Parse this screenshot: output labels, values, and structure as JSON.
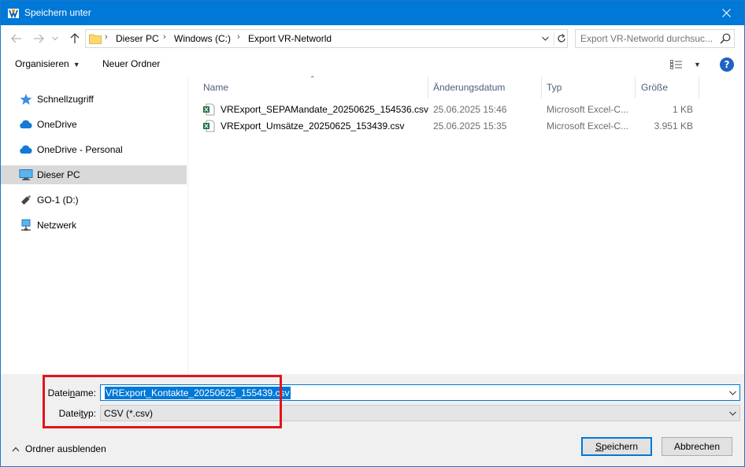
{
  "window": {
    "title": "Speichern unter"
  },
  "address_bar": {
    "crumbs": [
      "Dieser PC",
      "Windows (C:)",
      "Export VR-Networld"
    ]
  },
  "search": {
    "placeholder": "Export VR-Networld durchsuc..."
  },
  "toolbar": {
    "organize_label": "Organisieren",
    "new_folder_label": "Neuer Ordner"
  },
  "nav_pane": {
    "items": [
      {
        "label": "Schnellzugriff",
        "icon": "star-icon"
      },
      {
        "label": "OneDrive",
        "icon": "cloud-icon"
      },
      {
        "label": "OneDrive - Personal",
        "icon": "cloud-icon"
      },
      {
        "label": "Dieser PC",
        "icon": "computer-icon",
        "selected": true
      },
      {
        "label": "GO-1 (D:)",
        "icon": "usb-drive-icon"
      },
      {
        "label": "Netzwerk",
        "icon": "network-icon"
      }
    ]
  },
  "file_list": {
    "columns": {
      "name": "Name",
      "date": "Änderungsdatum",
      "type": "Typ",
      "size": "Größe"
    },
    "rows": [
      {
        "name": "VRExport_SEPAMandate_20250625_154536.csv",
        "date": "25.06.2025 15:46",
        "type": "Microsoft Excel-C...",
        "size": "1 KB"
      },
      {
        "name": "VRExport_Umsätze_20250625_153439.csv",
        "date": "25.06.2025 15:35",
        "type": "Microsoft Excel-C...",
        "size": "3.951 KB"
      }
    ]
  },
  "save_form": {
    "filename_label_pre": "Datei",
    "filename_label_u": "n",
    "filename_label_post": "ame:",
    "filename_value": "VRExport_Kontakte_20250625_155439.csv",
    "filetype_label_pre": "Datei",
    "filetype_label_u": "t",
    "filetype_label_post": "yp:",
    "filetype_value": "CSV (*.csv)"
  },
  "footer": {
    "hide_folders_label": "Ordner ausblenden",
    "save_label_u": "S",
    "save_label_rest": "peichern",
    "cancel_label": "Abbrechen"
  },
  "colors": {
    "titlebar": "#0078d7",
    "selection": "#0078d7",
    "highlight_box": "#e3131b"
  }
}
